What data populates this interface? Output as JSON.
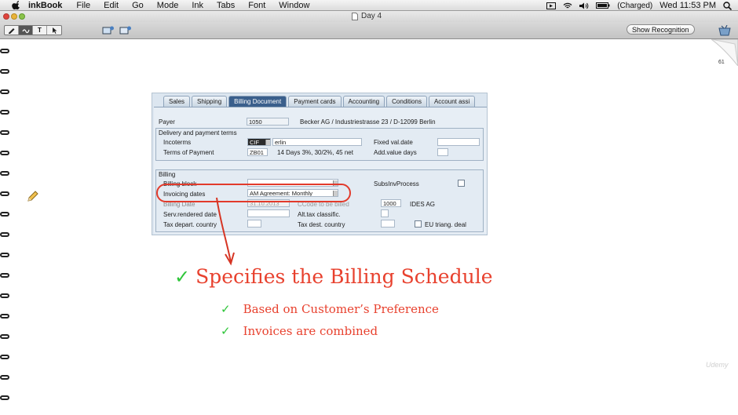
{
  "menubar": {
    "app_name": "inkBook",
    "items": [
      "File",
      "Edit",
      "Go",
      "Mode",
      "Ink",
      "Tabs",
      "Font",
      "Window"
    ],
    "battery": "(Charged)",
    "clock": "Wed 11:53 PM"
  },
  "window": {
    "title": "Day 4"
  },
  "toolbar": {
    "show_recognition": "Show Recognition"
  },
  "page": {
    "number": "61"
  },
  "sap": {
    "tabs": [
      "Sales",
      "Shipping",
      "Billing Document",
      "Payment cards",
      "Accounting",
      "Conditions",
      "Account assi"
    ],
    "payer_label": "Payer",
    "payer_value": "1050",
    "payer_address": "Becker AG / Industriestrasse 23 / D-12099 Berlin",
    "delivery_title": "Delivery and payment terms",
    "incoterms_label": "Incoterms",
    "incoterms_code": "CIF",
    "incoterms_place": "erlin",
    "fixed_val_label": "Fixed val.date",
    "terms_label": "Terms of Payment",
    "terms_code": "ZB01",
    "terms_text": "14 Days 3%, 30/2%, 45 net",
    "add_value_label": "Add.value days",
    "billing_title": "Billing",
    "billing_block_label": "Billing block",
    "subsinv_label": "SubsInvProcess",
    "invoicing_label": "Invoicing dates",
    "invoicing_value": "AM  Agreement: Monthly",
    "billing_date_label": "Billing Date",
    "billing_date_value": "31.10.2013",
    "ccode_label": "CCode to be billed",
    "ccode_value": "1000",
    "ccode_name": "IDES AG",
    "serv_label": "Serv.rendered date",
    "alt_tax_label": "Alt.tax classific.",
    "tax_depart_label": "Tax depart. country",
    "tax_dest_label": "Tax dest. country",
    "eu_label": "EU triang. deal"
  },
  "notes": {
    "heading": "Specifies the Billing Schedule",
    "bullets": [
      "Based on Customer’s Preference",
      "Invoices are combined"
    ]
  },
  "watermark": "Udemy",
  "colors": {
    "ink_red": "#e8412e",
    "check_green": "#2fc63a",
    "highlight_red": "#e23a2b"
  }
}
